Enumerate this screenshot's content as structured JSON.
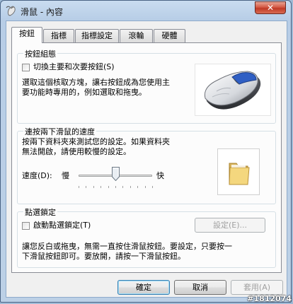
{
  "window": {
    "title": "滑鼠 - 內容",
    "close_label": "✕",
    "title_icon": "mouse-icon"
  },
  "tabs": [
    {
      "label": "按鈕",
      "active": true
    },
    {
      "label": "指標",
      "active": false
    },
    {
      "label": "指標設定",
      "active": false
    },
    {
      "label": "滾輪",
      "active": false
    },
    {
      "label": "硬體",
      "active": false
    }
  ],
  "button_config": {
    "title": "按鈕組態",
    "swap_checkbox_label": "切換主要和次要按鈕(S)",
    "swap_checked": false,
    "description_line1": "選取這個核取方塊，讓右按鈕成為您使用主",
    "description_line2": "要功能時專用的，例如選取和拖曳。",
    "illustration": "mouse-illustration"
  },
  "double_click": {
    "title": "連按兩下滑鼠的速度",
    "description_line1": "按兩下資料夾來測試您的設定。如果資料夾",
    "description_line2": "無法開啟，請使用較慢的設定。",
    "speed_label": "速度(D):",
    "slow_label": "慢",
    "fast_label": "快",
    "speed_level": 0.5,
    "test_icon": "folder-icon"
  },
  "click_lock": {
    "title": "點選鎖定",
    "checkbox_label": "啟動點選鎖定(T)",
    "checked": false,
    "settings_button": "設定(E)...",
    "description_line1": "讓您反白或拖曳，無需一直按住滑鼠按鈕。要設定，只要按一",
    "description_line2": "下滑鼠按鈕即可。要放開，請按一下滑鼠按鈕。"
  },
  "footer": {
    "ok": "確定",
    "cancel": "取消",
    "apply": "套用(A)"
  },
  "watermark": "#1812074"
}
